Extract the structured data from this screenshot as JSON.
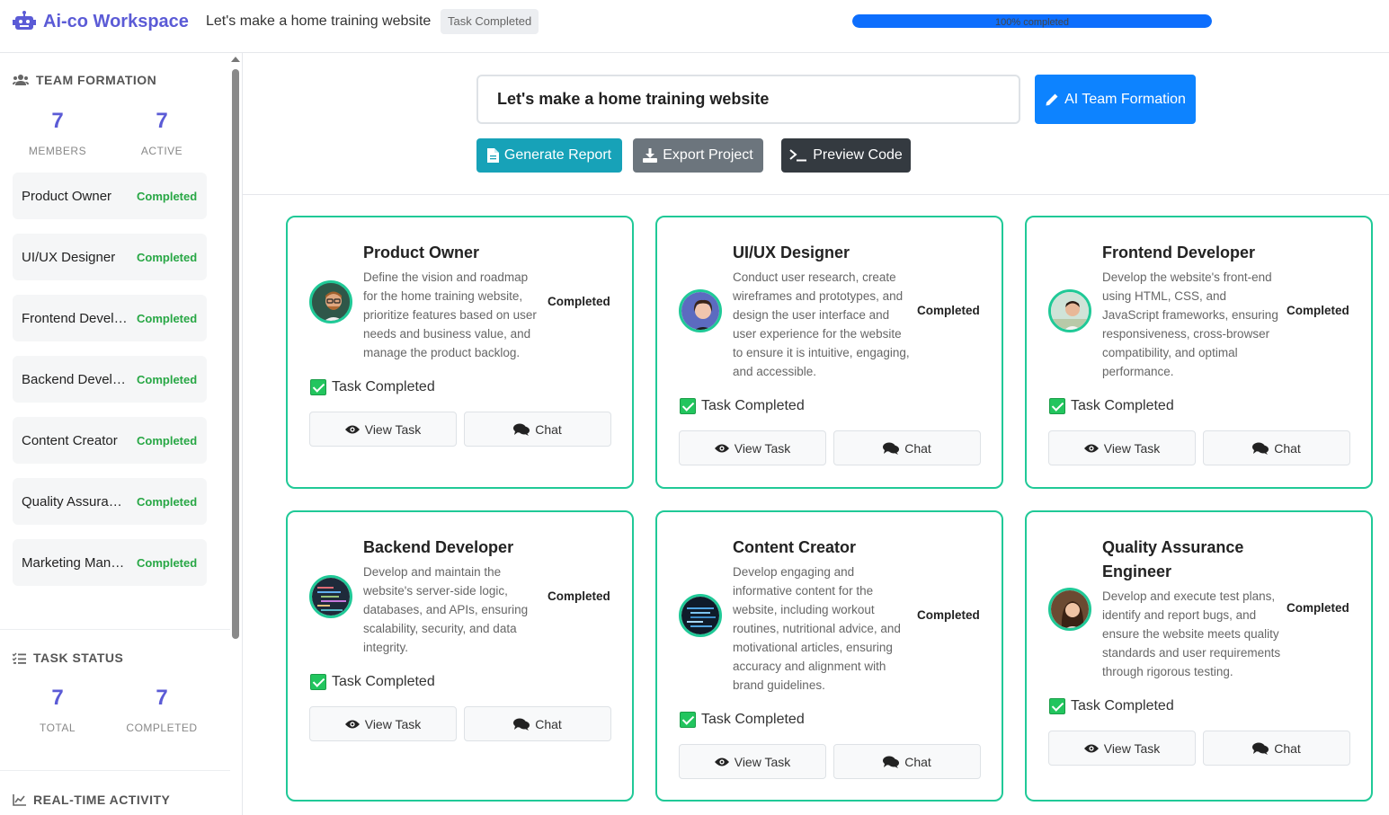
{
  "header": {
    "app_name": "Ai-co Workspace",
    "project_title": "Let's make a home training website",
    "status_badge": "Task Completed",
    "progress_label": "100% completed",
    "progress_value": 100
  },
  "sidebar": {
    "team_heading": "TEAM FORMATION",
    "team_stats": [
      {
        "value": "7",
        "label": "MEMBERS"
      },
      {
        "value": "7",
        "label": "ACTIVE"
      }
    ],
    "members": [
      {
        "name": "Product Owner",
        "status": "Completed"
      },
      {
        "name": "UI/UX Designer",
        "status": "Completed"
      },
      {
        "name": "Frontend Developer",
        "status": "Completed"
      },
      {
        "name": "Backend Developer",
        "status": "Completed"
      },
      {
        "name": "Content Creator",
        "status": "Completed"
      },
      {
        "name": "Quality Assurance Engineer",
        "status": "Completed"
      },
      {
        "name": "Marketing Manager",
        "status": "Completed"
      }
    ],
    "task_heading": "TASK STATUS",
    "task_stats": [
      {
        "value": "7",
        "label": "TOTAL"
      },
      {
        "value": "7",
        "label": "COMPLETED"
      }
    ],
    "activity_heading": "REAL-TIME ACTIVITY"
  },
  "main": {
    "project_input_value": "Let's make a home training website",
    "ai_team_button": "AI Team Formation",
    "generate_report_button": "Generate Report",
    "export_button": "Export Project",
    "preview_button": "Preview Code"
  },
  "cards": [
    {
      "title": "Product Owner",
      "desc": "Define the vision and roadmap for the home training website, prioritize features based on user needs and business value, and manage the product backlog.",
      "status": "Completed",
      "task": "Task Completed",
      "view": "View Task",
      "chat": "Chat"
    },
    {
      "title": "UI/UX Designer",
      "desc": "Conduct user research, create wireframes and prototypes, and design the user interface and user experience for the website to ensure it is intuitive, engaging, and accessible.",
      "status": "Completed",
      "task": "Task Completed",
      "view": "View Task",
      "chat": "Chat"
    },
    {
      "title": "Frontend Developer",
      "desc": "Develop the website's front-end using HTML, CSS, and JavaScript frameworks, ensuring responsiveness, cross-browser compatibility, and optimal performance.",
      "status": "Completed",
      "task": "Task Completed",
      "view": "View Task",
      "chat": "Chat"
    },
    {
      "title": "Backend Developer",
      "desc": "Develop and maintain the website's server-side logic, databases, and APIs, ensuring scalability, security, and data integrity.",
      "status": "Completed",
      "task": "Task Completed",
      "view": "View Task",
      "chat": "Chat"
    },
    {
      "title": "Content Creator",
      "desc": "Develop engaging and informative content for the website, including workout routines, nutritional advice, and motivational articles, ensuring accuracy and alignment with brand guidelines.",
      "status": "Completed",
      "task": "Task Completed",
      "view": "View Task",
      "chat": "Chat"
    },
    {
      "title": "Quality Assurance Engineer",
      "desc": "Develop and execute test plans, identify and report bugs, and ensure the website meets quality standards and user requirements through rigorous testing.",
      "status": "Completed",
      "task": "Task Completed",
      "view": "View Task",
      "chat": "Chat"
    }
  ],
  "colors": {
    "accent": "#5b5bd6",
    "success": "#28a745",
    "card_border": "#20c997",
    "primary": "#0d83ff"
  }
}
